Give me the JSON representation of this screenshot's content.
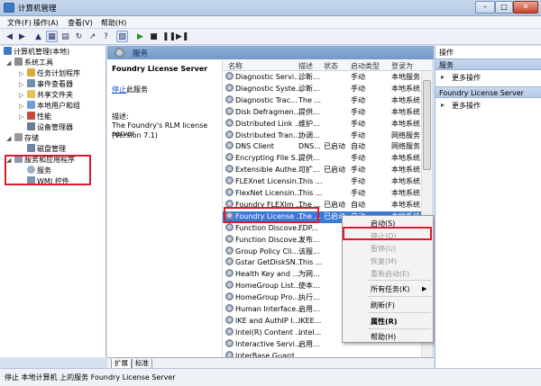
{
  "window": {
    "title": "计算机管理",
    "minimize": "–",
    "maximize": "□",
    "close": "✕"
  },
  "menu": [
    "文件(F)",
    "操作(A)",
    "查看(V)",
    "帮助(H)"
  ],
  "tree": [
    {
      "label": "计算机管理(本地)",
      "indent": 0
    },
    {
      "label": "系统工具",
      "indent": 1
    },
    {
      "label": "任务计划程序",
      "indent": 2
    },
    {
      "label": "事件查看器",
      "indent": 2
    },
    {
      "label": "共享文件夹",
      "indent": 2
    },
    {
      "label": "本地用户和组",
      "indent": 2
    },
    {
      "label": "性能",
      "indent": 2
    },
    {
      "label": "设备管理器",
      "indent": 2
    },
    {
      "label": "存储",
      "indent": 1
    },
    {
      "label": "磁盘管理",
      "indent": 2
    },
    {
      "label": "服务和应用程序",
      "indent": 1
    },
    {
      "label": "服务",
      "indent": 2
    },
    {
      "label": "WMI 控件",
      "indent": 2
    }
  ],
  "center": {
    "header": "服务",
    "service_name": "Foundry License Server",
    "stop_link": "停止",
    "stop_suffix": "此服务",
    "desc_label": "描述:",
    "desc_text": [
      "The Foundry's RLM license server",
      "(Version 7.1)"
    ]
  },
  "columns": [
    "名称",
    "描述",
    "状态",
    "启动类型",
    "登录为"
  ],
  "services": [
    {
      "name": "Diagnostic Servi...",
      "desc": "诊断...",
      "status": "",
      "startup": "手动",
      "logon": "本地服务"
    },
    {
      "name": "Diagnostic Syste...",
      "desc": "诊断...",
      "status": "",
      "startup": "手动",
      "logon": "本地系统"
    },
    {
      "name": "Diagnostic Trac...",
      "desc": "The ...",
      "status": "",
      "startup": "手动",
      "logon": "本地系统"
    },
    {
      "name": "Disk Defragmen...",
      "desc": "提供...",
      "status": "",
      "startup": "手动",
      "logon": "本地系统"
    },
    {
      "name": "Distributed Link ...",
      "desc": "维护...",
      "status": "",
      "startup": "手动",
      "logon": "本地系统"
    },
    {
      "name": "Distributed Tran...",
      "desc": "协调...",
      "status": "",
      "startup": "手动",
      "logon": "网络服务"
    },
    {
      "name": "DNS Client",
      "desc": "DNS...",
      "status": "已启动",
      "startup": "自动",
      "logon": "网络服务"
    },
    {
      "name": "Encrypting File S...",
      "desc": "提供...",
      "status": "",
      "startup": "手动",
      "logon": "本地系统"
    },
    {
      "name": "Extensible Authe...",
      "desc": "可扩...",
      "status": "已启动",
      "startup": "手动",
      "logon": "本地系统"
    },
    {
      "name": "FLEXnet Licensin...",
      "desc": "This ...",
      "status": "",
      "startup": "手动",
      "logon": "本地系统"
    },
    {
      "name": "FlexNet Licensin...",
      "desc": "This ...",
      "status": "",
      "startup": "手动",
      "logon": "本地系统"
    },
    {
      "name": "Foundry FLEXlm ...",
      "desc": "The ...",
      "status": "已启动",
      "startup": "自动",
      "logon": "本地系统"
    },
    {
      "name": "Foundry License ...",
      "desc": "The ...",
      "status": "已启动",
      "startup": "自动",
      "logon": "本地系统"
    },
    {
      "name": "Function Discove...",
      "desc": "FDP...",
      "status": "",
      "startup": "",
      "logon": ""
    },
    {
      "name": "Function Discove...",
      "desc": "发布...",
      "status": "",
      "startup": "",
      "logon": ""
    },
    {
      "name": "Group Policy Cli...",
      "desc": "该服...",
      "status": "",
      "startup": "",
      "logon": ""
    },
    {
      "name": "Gstar GetDiskSN...",
      "desc": "This ...",
      "status": "",
      "startup": "",
      "logon": ""
    },
    {
      "name": "Health Key and ...",
      "desc": "为网...",
      "status": "",
      "startup": "",
      "logon": ""
    },
    {
      "name": "HomeGroup List...",
      "desc": "使本...",
      "status": "",
      "startup": "",
      "logon": ""
    },
    {
      "name": "HomeGroup Pro...",
      "desc": "执行...",
      "status": "",
      "startup": "",
      "logon": ""
    },
    {
      "name": "Human Interface...",
      "desc": "启用...",
      "status": "",
      "startup": "",
      "logon": ""
    },
    {
      "name": "IKE and AuthIP I...",
      "desc": "IKEE...",
      "status": "",
      "startup": "",
      "logon": ""
    },
    {
      "name": "Intel(R) Content ...",
      "desc": "Intel...",
      "status": "",
      "startup": "",
      "logon": ""
    },
    {
      "name": "Interactive Servi...",
      "desc": "启用...",
      "status": "",
      "startup": "",
      "logon": ""
    },
    {
      "name": "InterBase Guard...",
      "desc": "",
      "status": "",
      "startup": "",
      "logon": ""
    }
  ],
  "selected_index": 12,
  "context_menu": [
    {
      "label": "启动(S)",
      "disabled": false
    },
    {
      "label": "停止(O)",
      "disabled": true
    },
    {
      "label": "暂停(U)",
      "disabled": true
    },
    {
      "label": "恢复(M)",
      "disabled": true
    },
    {
      "label": "重新启动(E)",
      "disabled": true
    },
    {
      "label": "所有任务(K)",
      "disabled": false,
      "submenu": true
    },
    {
      "label": "刷新(F)",
      "disabled": false
    },
    {
      "label": "属性(R)",
      "disabled": false,
      "bold": true
    },
    {
      "label": "帮助(H)",
      "disabled": false
    }
  ],
  "tabs": [
    "扩展",
    "标准"
  ],
  "actions": {
    "title": "操作",
    "section1": "服务",
    "more1": "更多操作",
    "section2": "Foundry License Server",
    "more2": "更多操作"
  },
  "status_bar": "停止 本地计算机 上的服务 Foundry License Server",
  "colors": {
    "highlight": "#e0182a",
    "selection": "#3a7bd6"
  }
}
